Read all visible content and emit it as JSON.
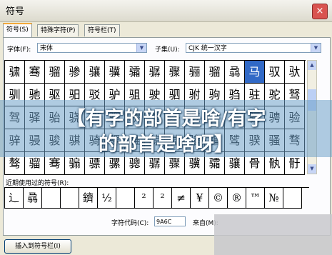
{
  "window": {
    "title": "符号",
    "close": "×"
  },
  "tabs": [
    "符号(S)",
    "特殊字符(P)",
    "符号栏(T)"
  ],
  "font": {
    "label": "字体(F):",
    "value": "宋体"
  },
  "subset": {
    "label": "子集(U):",
    "value": "CJK 统一汉字"
  },
  "grid": [
    [
      "骕",
      "骞",
      "骝",
      "骖",
      "骧",
      "骥",
      "骦",
      "骣",
      "骤",
      "骊",
      "骝",
      "骉",
      "马",
      "驭",
      "驮"
    ],
    [
      "驯",
      "驰",
      "驱",
      "驲",
      "驳",
      "驴",
      "驵",
      "驶",
      "驷",
      "驸",
      "驹",
      "驺",
      "驻",
      "驼",
      "驽"
    ],
    [
      "驾",
      "驿",
      "骀",
      "骁",
      "骂",
      "骃",
      "骄",
      "骅",
      "骆",
      "骇",
      "骈",
      "骉",
      "骊",
      "骋",
      "验"
    ],
    [
      "骍",
      "骎",
      "骏",
      "骐",
      "骑",
      "骒",
      "骓",
      "骔",
      "骕",
      "骖",
      "骗",
      "骘",
      "骙",
      "骚",
      "骛"
    ],
    [
      "骜",
      "骝",
      "骞",
      "骟",
      "骠",
      "骡",
      "骢",
      "骣",
      "骤",
      "骥",
      "骦",
      "骧",
      "骨",
      "骫",
      "骬"
    ]
  ],
  "selected_char": "马",
  "recent": {
    "label": "近期使用过的符号(R):",
    "chars": [
      "辶",
      "骉",
      "",
      "",
      "鑇",
      "½",
      "",
      "²",
      "²",
      "≠",
      "¥",
      "©",
      "®",
      "™",
      "№",
      ""
    ]
  },
  "code": {
    "label": "字符代码(C):",
    "value": "9A6C"
  },
  "from": {
    "label": "来自(M):"
  },
  "insert_button": "插入到符号栏(I)",
  "banner": {
    "line1": "【有字的部首是啥/有字",
    "line2": "的部首是啥呀】"
  }
}
